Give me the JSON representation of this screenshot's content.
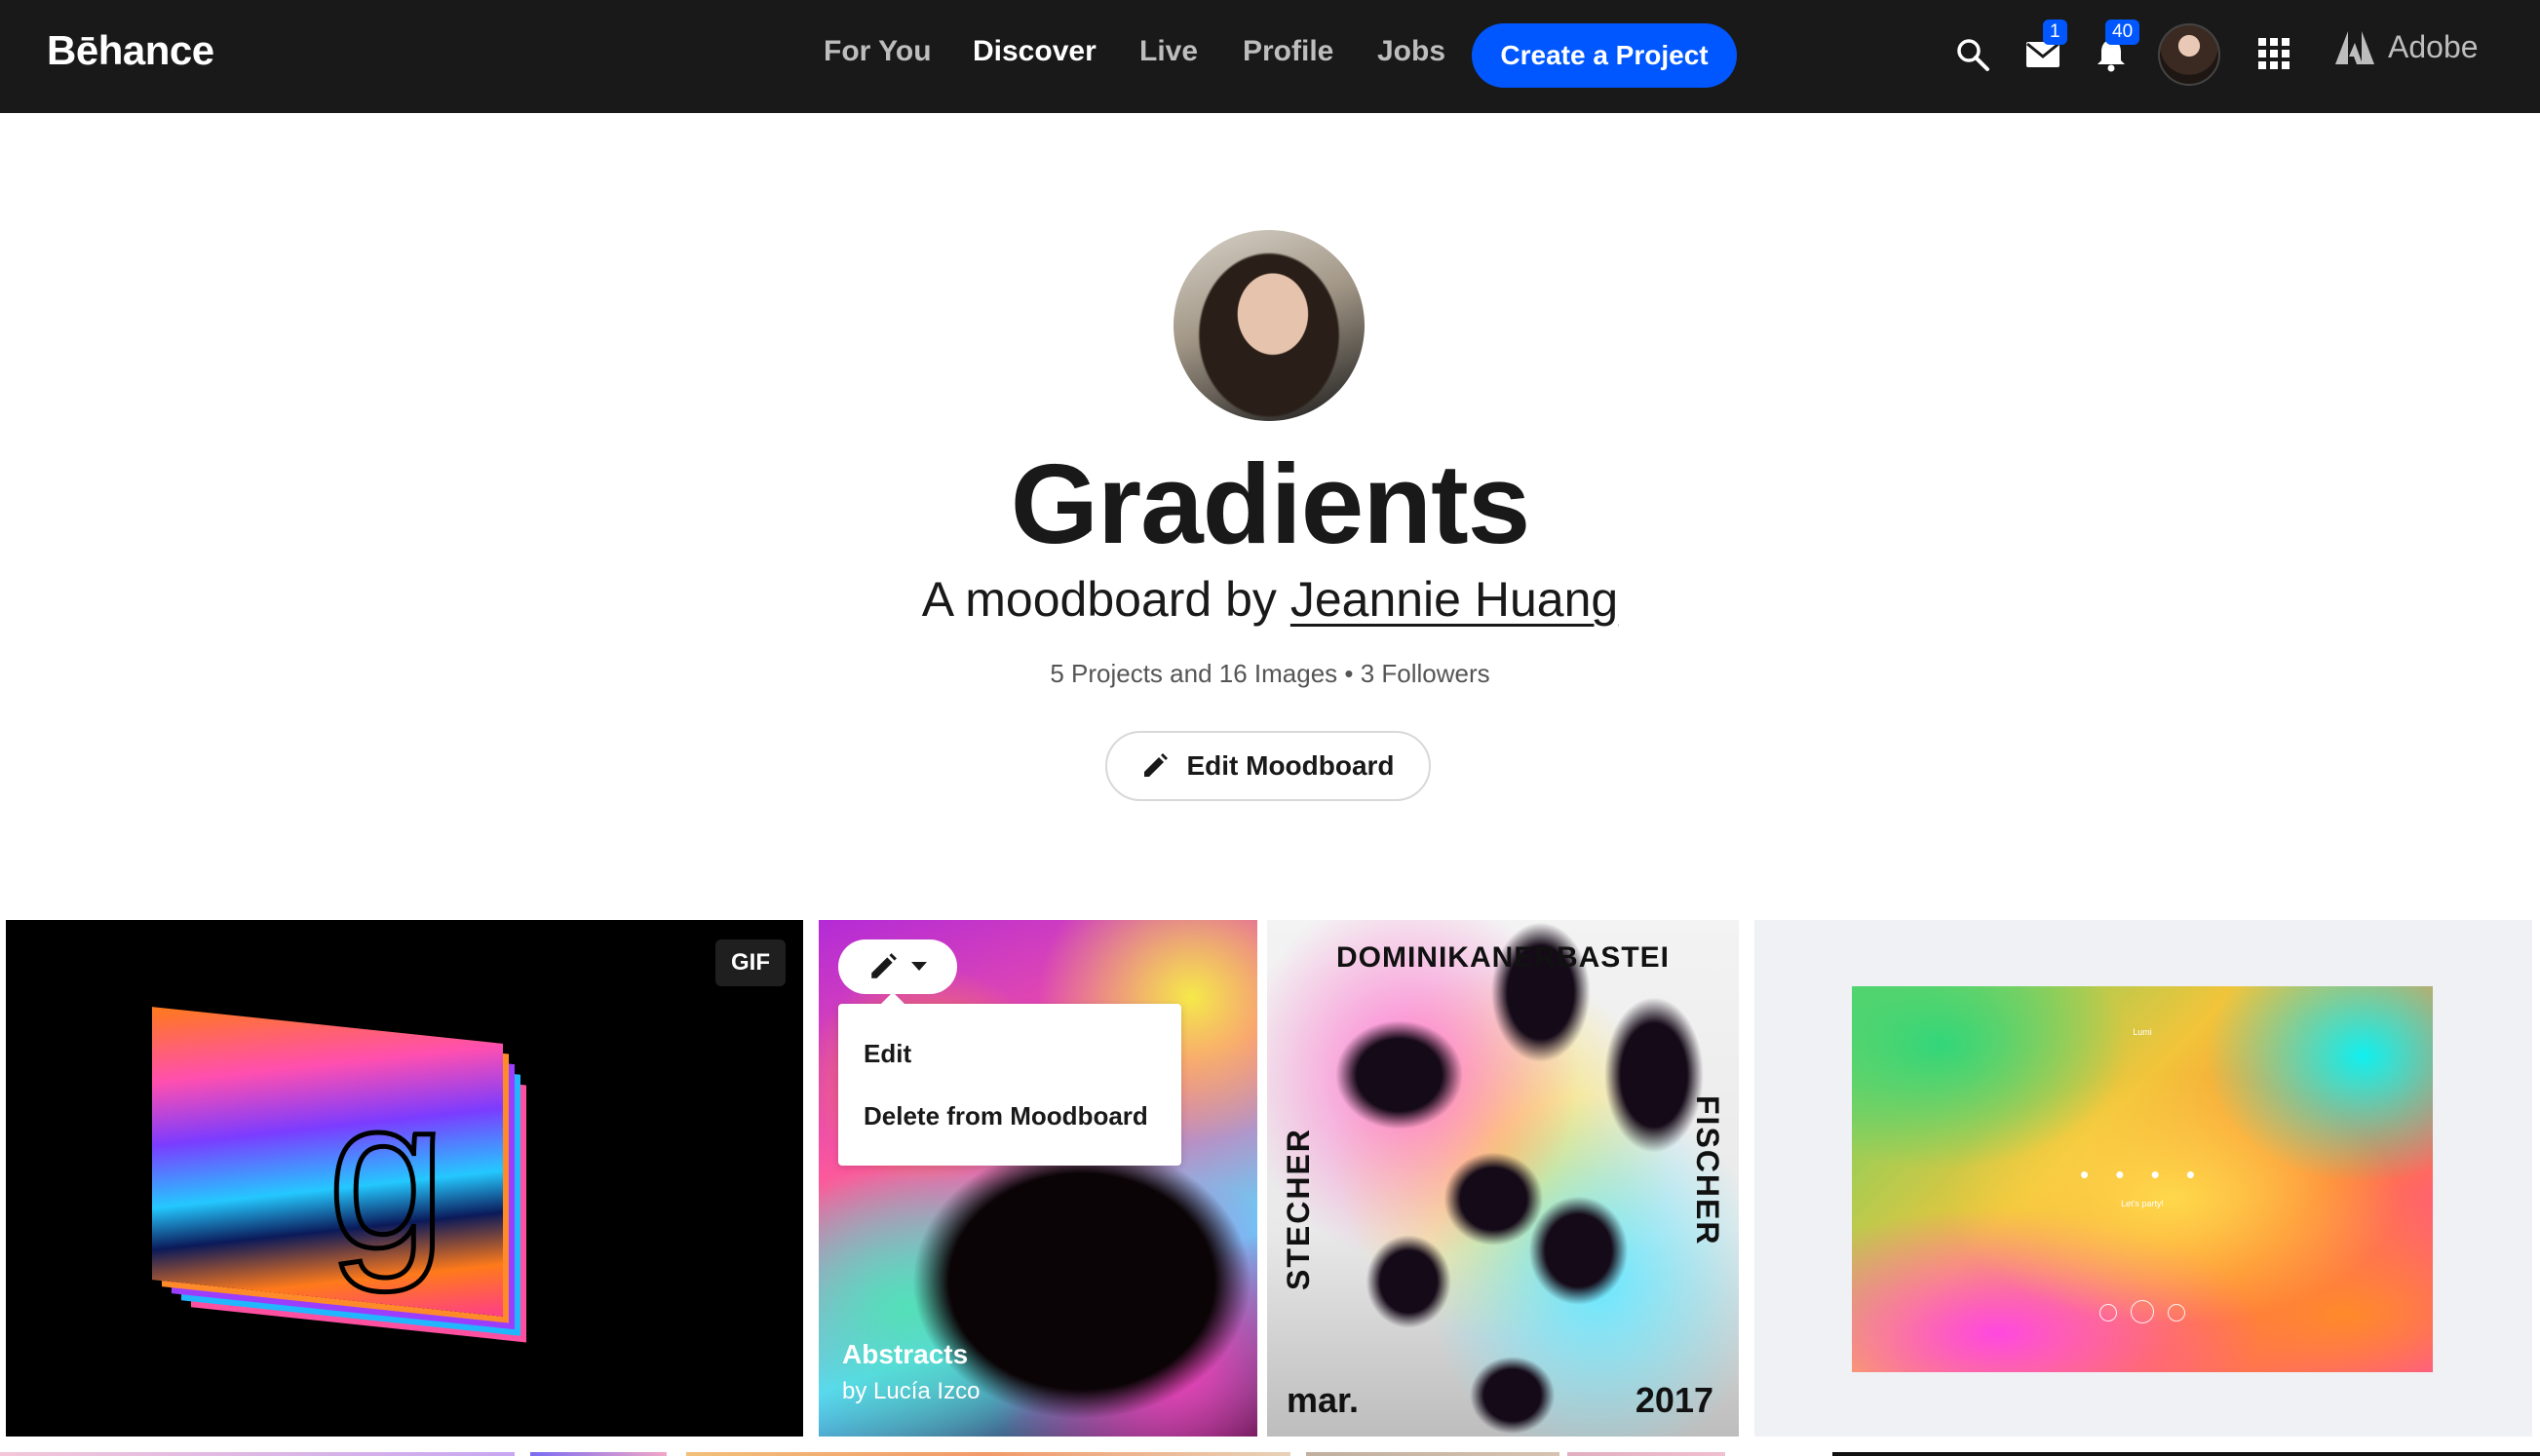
{
  "nav": {
    "logo": "Bēhance",
    "links": [
      "For You",
      "Discover",
      "Live",
      "Profile",
      "Jobs"
    ],
    "active_link": "Discover",
    "create_label": "Create a Project",
    "messages_badge": "1",
    "notifications_badge": "40",
    "adobe_label": "Adobe"
  },
  "hero": {
    "title": "Gradients",
    "byline_prefix": "A moodboard by",
    "owner": "Jeannie Huang",
    "stats": "5 Projects and 16 Images • 3 Followers",
    "edit_label": "Edit Moodboard"
  },
  "tiles": {
    "gif_badge": "GIF",
    "gif_glyph": "g",
    "menu_items": [
      "Edit",
      "Delete from Moodboard"
    ],
    "project_title": "Abstracts",
    "project_owner": "by Lucía Izco",
    "poster_top": "DOMINIKANERBASTEI",
    "poster_left": "STECHER",
    "poster_right": "FISCHER",
    "poster_bottom_left": "mar.",
    "poster_bottom_right": "2017",
    "screen_label": "Lumi",
    "screen_dots": "• • • •",
    "screen_sub": "Let's party!"
  },
  "colors": {
    "nav_bg": "#191919",
    "accent": "#0057ff",
    "text": "#191919"
  }
}
